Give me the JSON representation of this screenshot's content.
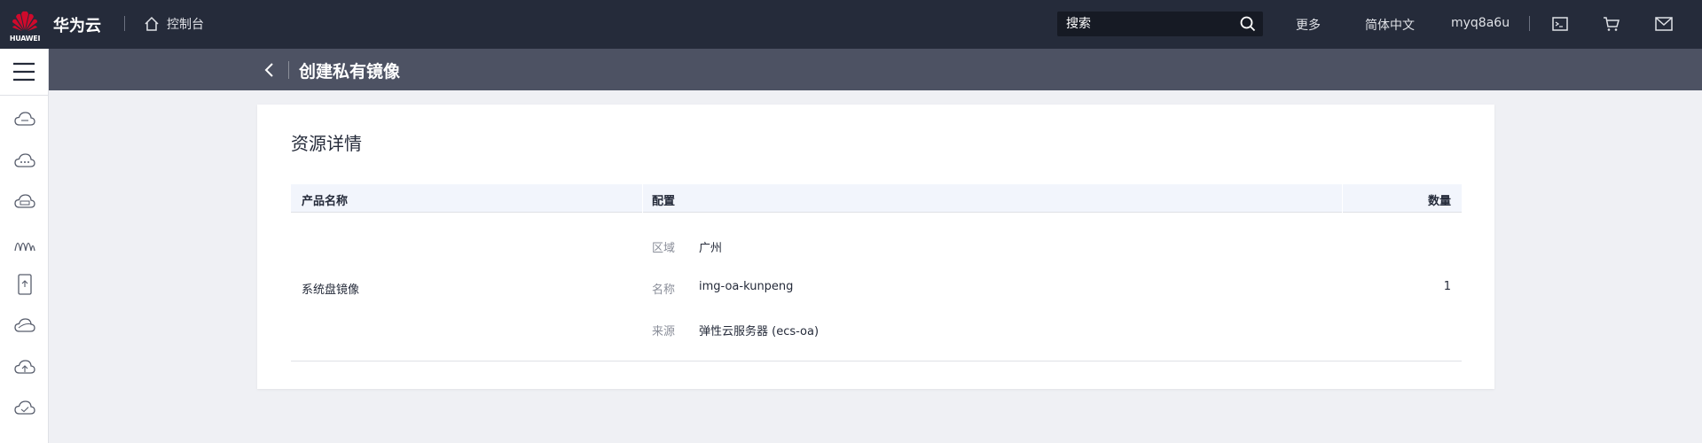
{
  "topbar": {
    "logo_text": "HUAWEI",
    "brand": "华为云",
    "console_label": "控制台",
    "search_placeholder": "搜索",
    "more_label": "更多",
    "language_label": "简体中文",
    "username": "myq8a6u"
  },
  "titlebar": {
    "title": "创建私有镜像"
  },
  "sidebar": {
    "icons": [
      "menu-icon",
      "cloud-icon",
      "cloud-dots-icon",
      "cloud-db-icon",
      "network-icon",
      "storage-device-icon",
      "cloud-ring-icon",
      "cloud-upload-icon",
      "cloud-check-icon"
    ]
  },
  "card": {
    "section_title": "资源详情",
    "table": {
      "columns": [
        "产品名称",
        "配置",
        "数量"
      ],
      "rows": [
        {
          "product": "系统盘镜像",
          "config": [
            {
              "label": "区域",
              "value": "广州"
            },
            {
              "label": "名称",
              "value": "img-oa-kunpeng"
            },
            {
              "label": "来源",
              "value": "弹性云服务器 (ecs-oa)"
            }
          ],
          "quantity": "1"
        }
      ]
    }
  },
  "colors": {
    "topbar_bg": "#252b3a",
    "titlebar_bg": "#4d5263",
    "page_bg": "#eff0f4",
    "table_header_bg": "#f2f5fc",
    "logo_red": "#cf0a2c"
  }
}
